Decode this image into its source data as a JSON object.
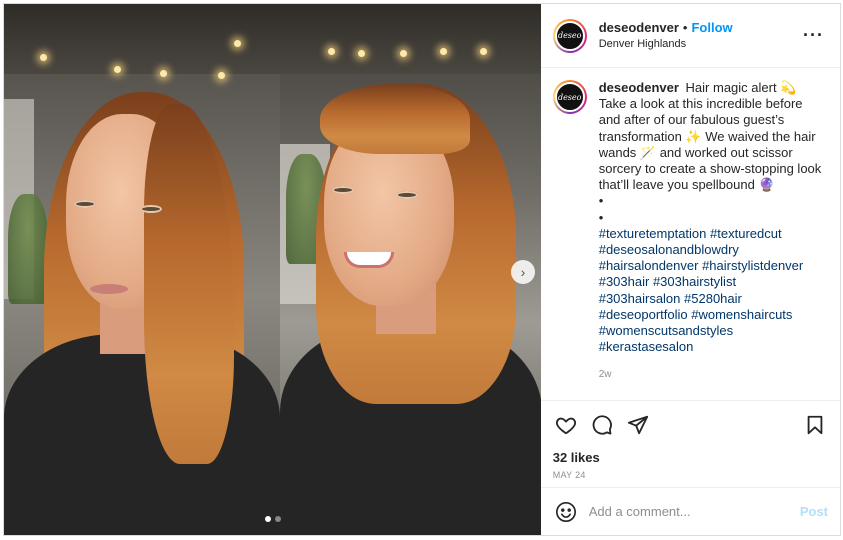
{
  "post": {
    "author": {
      "username": "deseodenver",
      "location": "Denver Highlands",
      "follow_label": "Follow",
      "separator": "•",
      "avatar_text": "deseo"
    },
    "more_icon": "more-horizontal-icon",
    "media": {
      "next_icon": "chevron-right-icon",
      "next_glyph": "›",
      "slides": 2,
      "active_slide": 1
    },
    "caption": {
      "username": "deseodenver",
      "lines": [
        "Hair magic alert 💫",
        "Take a look at this incredible before and after of our fabulous guest’s transformation ✨ We waived the hair wands 🪄 and worked out scissor sorcery to create a show-stopping look that’ll leave you spellbound 🔮",
        "•",
        "•"
      ],
      "hashtags": [
        "#texturetemptation",
        "#texturedcut",
        "#deseosalonandblowdry",
        "#hairsalondenver",
        "#hairstylistdenver",
        "#303hair",
        "#303hairstylist",
        "#303hairsalon",
        "#5280hair",
        "#deseoportfolio",
        "#womenshaircuts",
        "#womenscutsandstyles",
        "#kerastasesalon"
      ],
      "time_ago": "2w"
    },
    "actions": {
      "like_icon": "heart-icon",
      "comment_icon": "comment-icon",
      "share_icon": "send-icon",
      "save_icon": "bookmark-icon"
    },
    "likes": "32 likes",
    "date": "MAY 24",
    "comment": {
      "emoji_icon": "smiley-icon",
      "placeholder": "Add a comment...",
      "value": "",
      "post_label": "Post"
    }
  },
  "colors": {
    "follow": "#0095f6",
    "hashtag": "#00376b",
    "muted": "#8e8e8e",
    "post_disabled": "#b2dffc",
    "border": "#dbdbdb"
  }
}
